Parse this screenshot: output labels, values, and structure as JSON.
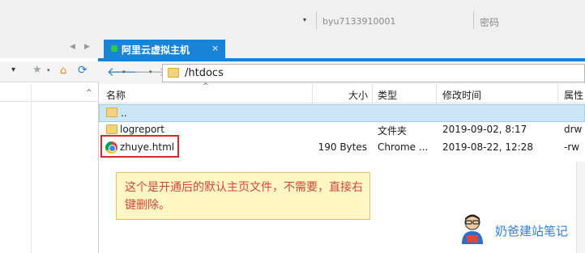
{
  "connection": {
    "username": "byu7133910001",
    "password_placeholder": "密码"
  },
  "tab": {
    "label": "阿里云虚拟主机",
    "close": "×"
  },
  "remote": {
    "path": "/htdocs",
    "columns": {
      "name": "名称",
      "size": "大小",
      "type": "类型",
      "modified": "修改时间",
      "attributes": "属性"
    },
    "parent_dir": "..",
    "files": [
      {
        "name": "logreport",
        "size": "",
        "type": "文件夹",
        "modified": "2019-09-02, 8:17",
        "attr": "drw"
      },
      {
        "name": "zhuye.html",
        "size": "190 Bytes",
        "type": "Chrome ...",
        "modified": "2019-08-22, 12:28",
        "attr": "-rw"
      }
    ]
  },
  "annotation": {
    "text": "这个是开通后的默认主页文件，不需要，直接右键删除。"
  },
  "watermark": {
    "text": "奶爸建站笔记"
  },
  "icons": {
    "dropdown": "▾",
    "nav_left": "◀",
    "nav_right": "▶",
    "back": "🡐",
    "forward": "🡒",
    "star": "★",
    "home": "⌂",
    "refresh": "⟳",
    "sort_up": "^"
  }
}
